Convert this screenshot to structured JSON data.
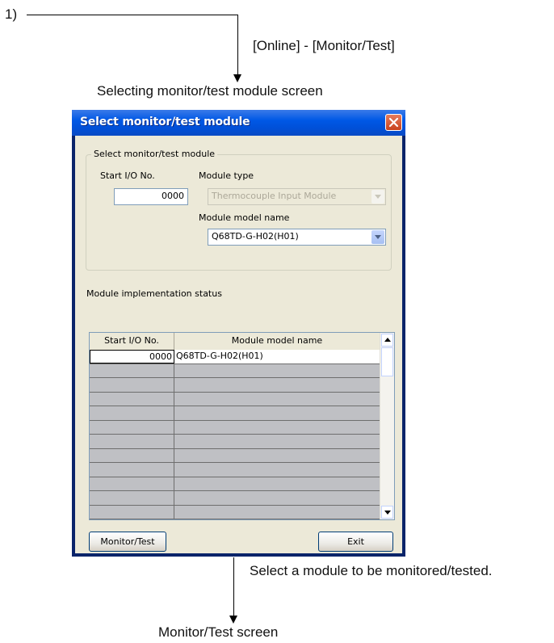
{
  "flow": {
    "step_label": "1)",
    "menu_path": "[Online] - [Monitor/Test]",
    "screen_caption": "Selecting monitor/test module screen",
    "action_note": "Select a module to be monitored/tested.",
    "result_caption": "Monitor/Test screen"
  },
  "dialog": {
    "title": "Select monitor/test module",
    "close_icon": "close-icon",
    "group_label": "Select monitor/test module",
    "start_io_label": "Start I/O No.",
    "start_io_value": "0000",
    "module_type_label": "Module type",
    "module_type_value": "Thermocouple Input Module",
    "model_name_label": "Module model name",
    "model_name_value": "Q68TD-G-H02(H01)",
    "status_label": "Module implementation status",
    "table": {
      "columns": [
        "Start I/O No.",
        "Module model name"
      ],
      "rows": [
        {
          "start_io": "0000",
          "model": "Q68TD-G-H02(H01)"
        },
        {
          "start_io": "",
          "model": ""
        },
        {
          "start_io": "",
          "model": ""
        },
        {
          "start_io": "",
          "model": ""
        },
        {
          "start_io": "",
          "model": ""
        },
        {
          "start_io": "",
          "model": ""
        },
        {
          "start_io": "",
          "model": ""
        },
        {
          "start_io": "",
          "model": ""
        },
        {
          "start_io": "",
          "model": ""
        },
        {
          "start_io": "",
          "model": ""
        },
        {
          "start_io": "",
          "model": ""
        },
        {
          "start_io": "",
          "model": ""
        }
      ]
    },
    "monitor_button": "Monitor/Test",
    "exit_button": "Exit"
  },
  "colors": {
    "titlebar": "#0058e6",
    "dialog_face": "#ece9d8",
    "close_button": "#c8421e",
    "empty_row": "#bfc0c4"
  }
}
